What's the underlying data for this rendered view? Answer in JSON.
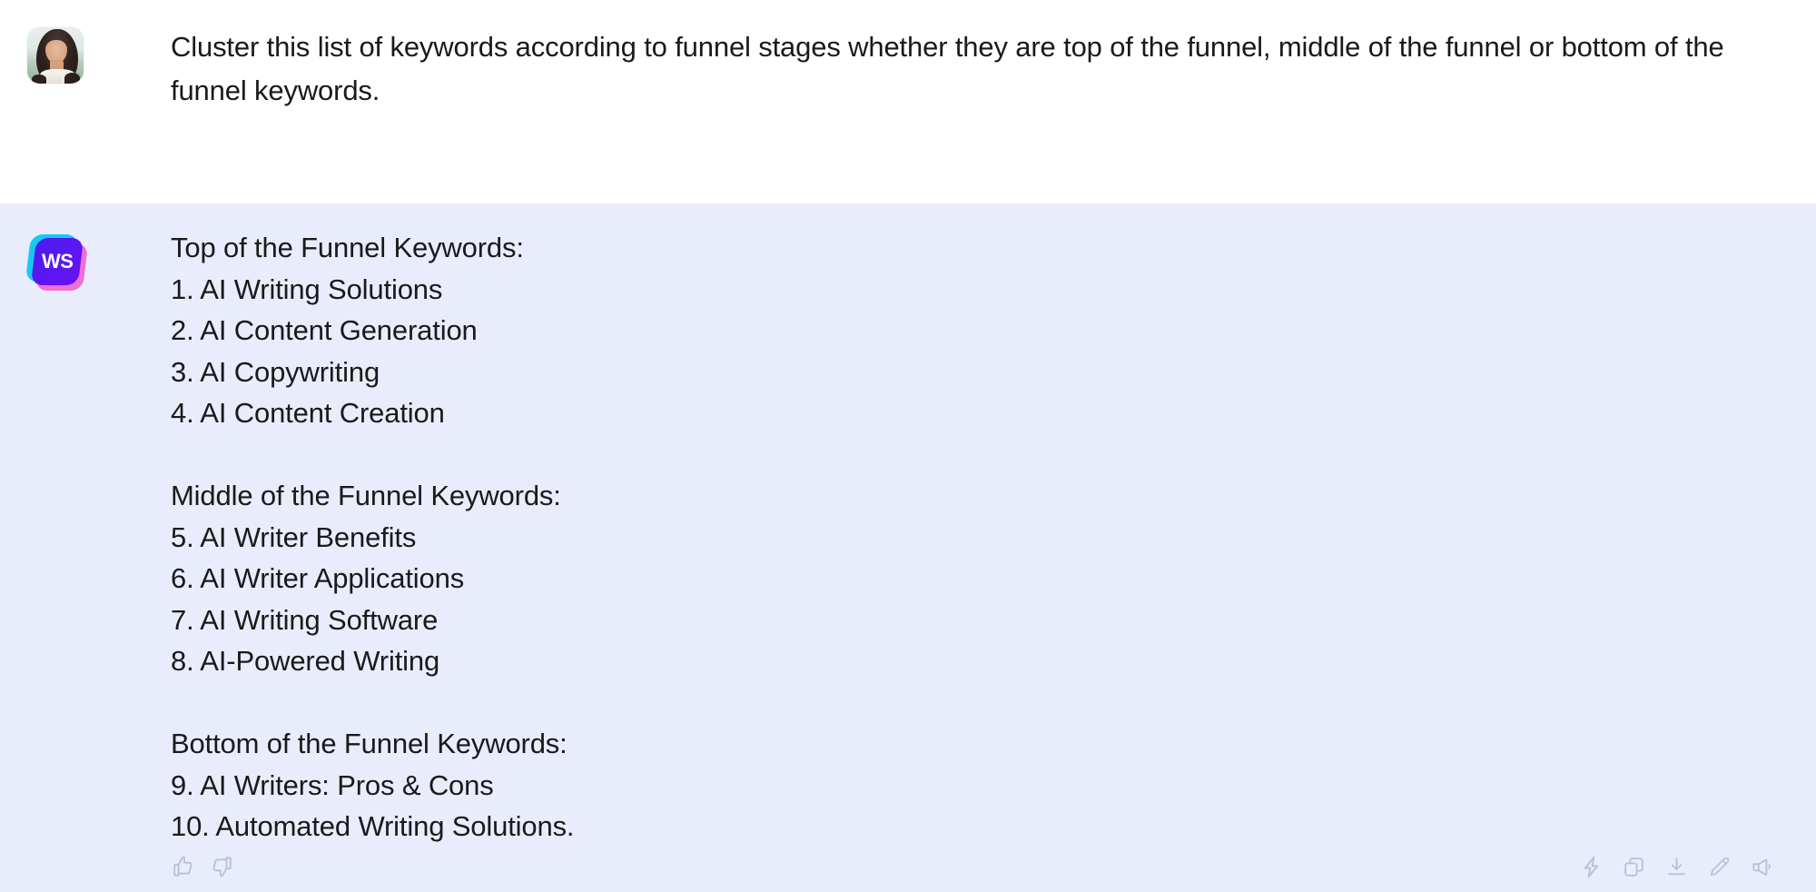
{
  "conversation": {
    "user_message": {
      "avatar_name": "user-avatar-photo",
      "text": "Cluster this list of keywords according to funnel stages whether they are top of the funnel, middle of the funnel or bottom of the funnel keywords."
    },
    "assistant_message": {
      "logo_text": "WS",
      "lines": [
        "Top of the Funnel Keywords:",
        "1. AI Writing Solutions",
        "2. AI Content Generation",
        "3. AI Copywriting",
        "4. AI Content Creation",
        "",
        "Middle of the Funnel Keywords:",
        "5. AI Writer Benefits",
        "6. AI Writer Applications",
        "7. AI Writing Software",
        "8. AI-Powered Writing",
        "",
        "Bottom of the Funnel Keywords:",
        "9. AI Writers: Pros & Cons",
        "10. Automated Writing Solutions."
      ]
    },
    "actions": {
      "left": [
        {
          "icon": "thumbs-up-icon",
          "label": "Like"
        },
        {
          "icon": "thumbs-down-icon",
          "label": "Dislike"
        }
      ],
      "right": [
        {
          "icon": "lightning-bolt-icon",
          "label": "Improve"
        },
        {
          "icon": "copy-icon",
          "label": "Copy"
        },
        {
          "icon": "download-icon",
          "label": "Download"
        },
        {
          "icon": "pencil-icon",
          "label": "Edit"
        },
        {
          "icon": "megaphone-icon",
          "label": "Publish"
        }
      ]
    }
  },
  "colors": {
    "page_background": "#ffffff",
    "assistant_background": "#e9edfb",
    "text": "#1a1a1a",
    "icon": "#b8c0d9",
    "logo_blue": "#5b16f2",
    "logo_cyan": "#18c8f0",
    "logo_pink": "#f06ed0"
  }
}
